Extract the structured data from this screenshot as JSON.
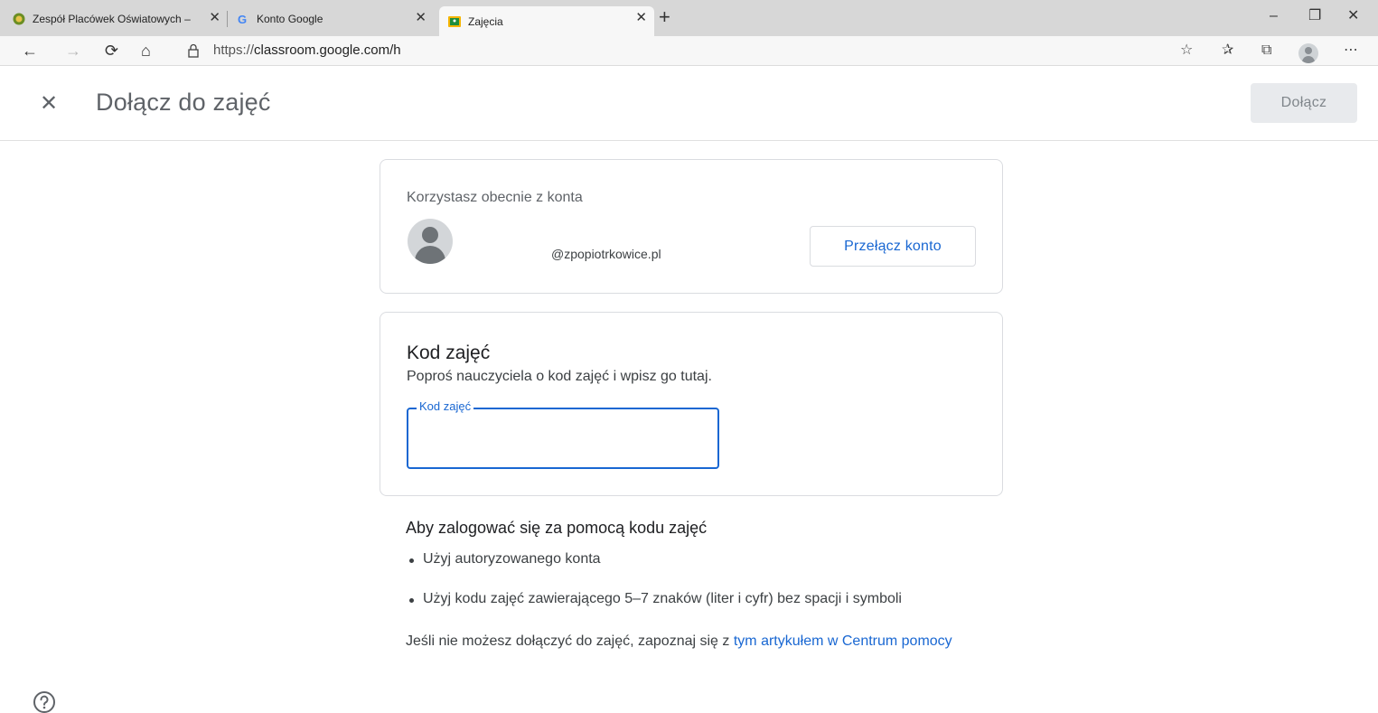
{
  "browser": {
    "tabs": [
      {
        "title": "Zespół Placówek Oświatowych –",
        "icon": "school-favicon-icon",
        "active": false
      },
      {
        "title": "Konto Google",
        "icon": "google-g-icon",
        "active": false
      },
      {
        "title": "Zajęcia",
        "icon": "classroom-favicon-icon",
        "active": true
      }
    ],
    "new_tab_label": "+",
    "url_scheme": "https://",
    "url_rest": "classroom.google.com/h",
    "window_controls": {
      "minimize": "–",
      "maximize": "❐",
      "close": "✕"
    }
  },
  "header": {
    "close_glyph": "✕",
    "title": "Dołącz do zajęć",
    "join_button": "Dołącz"
  },
  "account": {
    "label": "Korzystasz obecnie z konta",
    "email": "@zpopiotrkowice.pl",
    "switch_button": "Przełącz konto"
  },
  "class_code": {
    "title": "Kod zajęć",
    "description": "Poproś nauczyciela o kod zajęć i wpisz go tutaj.",
    "field_label": "Kod zajęć",
    "field_value": ""
  },
  "info": {
    "title": "Aby zalogować się za pomocą kodu zajęć",
    "items": [
      "Użyj autoryzowanego konta",
      "Użyj kodu zajęć zawierającego 5–7 znaków (liter i cyfr) bez spacji i symboli"
    ],
    "footer_text": "Jeśli nie możesz dołączyć do zajęć, zapoznaj się z ",
    "footer_link": "tym artykułem w Centrum pomocy"
  },
  "colors": {
    "accent": "#1967d2",
    "text_secondary": "#5f6368",
    "border": "#dadce0"
  }
}
